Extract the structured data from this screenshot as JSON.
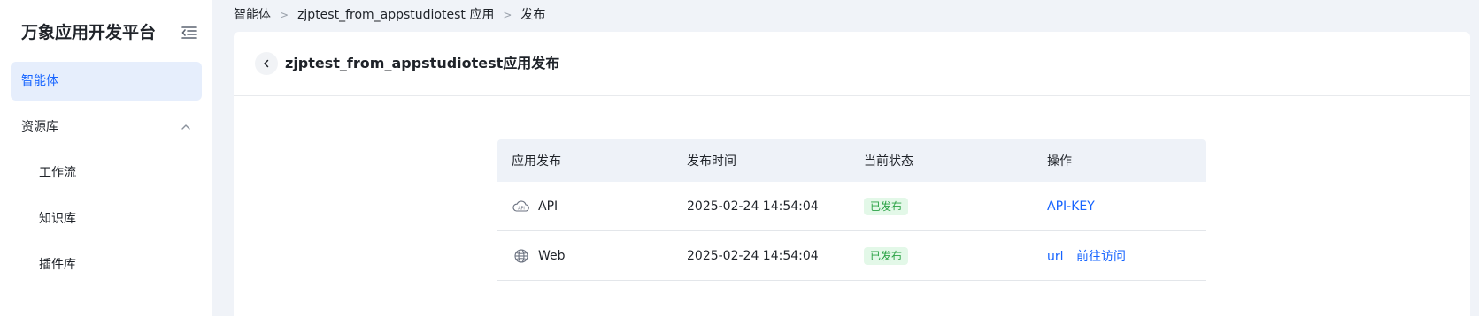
{
  "sidebar": {
    "brand": "万象应用开发平台",
    "items": [
      {
        "label": "智能体",
        "active": true
      },
      {
        "label": "资源库",
        "expanded": true
      },
      {
        "label": "工作流"
      },
      {
        "label": "知识库"
      },
      {
        "label": "插件库"
      }
    ]
  },
  "breadcrumb": [
    "智能体",
    "zjptest_from_appstudiotest 应用",
    "发布"
  ],
  "page": {
    "title": "zjptest_from_appstudiotest应用发布"
  },
  "table": {
    "headers": [
      "应用发布",
      "发布时间",
      "当前状态",
      "操作"
    ],
    "rows": [
      {
        "channel": "API",
        "icon": "api-cloud-icon",
        "time": "2025-02-24 14:54:04",
        "status": "已发布",
        "actions": [
          "API-KEY"
        ]
      },
      {
        "channel": "Web",
        "icon": "globe-icon",
        "time": "2025-02-24 14:54:04",
        "status": "已发布",
        "actions": [
          "url",
          "前往访问"
        ]
      }
    ]
  },
  "colors": {
    "accent": "#1664ff",
    "active_bg": "#e6eefc",
    "success_text": "#2ba245",
    "success_bg": "#e3f8e8"
  }
}
